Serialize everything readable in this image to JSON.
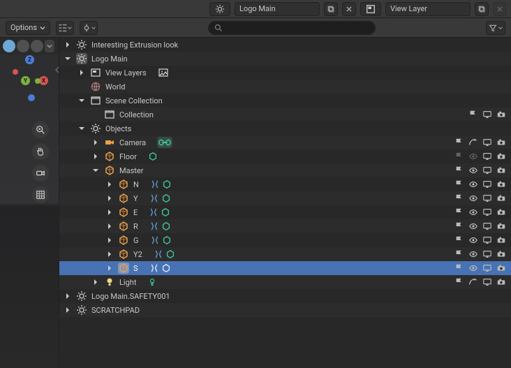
{
  "header": {
    "scene_field_label": "Logo Main",
    "layer_field_label": "View Layer"
  },
  "toolbar": {
    "options_label": "Options",
    "search_placeholder": ""
  },
  "outliner": {
    "rows": [
      {
        "depth": 0,
        "tw": "r",
        "icon": "scene",
        "label": "Interesting Extrusion look",
        "alt": false,
        "right": []
      },
      {
        "depth": 0,
        "tw": "d",
        "icon": "scene",
        "label": "Logo Main",
        "alt": true,
        "boxed": true,
        "right": []
      },
      {
        "depth": 1,
        "tw": "r",
        "icon": "layers",
        "label": "View Layers",
        "alt": false,
        "extra": "img",
        "right": []
      },
      {
        "depth": 1,
        "tw": "",
        "icon": "world",
        "label": "World",
        "alt": true,
        "right": []
      },
      {
        "depth": 1,
        "tw": "d",
        "icon": "collection",
        "label": "Scene Collection",
        "alt": false,
        "right": []
      },
      {
        "depth": 2,
        "tw": "",
        "icon": "collection",
        "label": "Collection",
        "alt": true,
        "right": [
          "flag",
          "screen",
          "render"
        ]
      },
      {
        "depth": 1,
        "tw": "d",
        "icon": "scene",
        "label": "Objects",
        "alt": false,
        "right": []
      },
      {
        "depth": 2,
        "tw": "r",
        "icon": "camera",
        "label": "Camera",
        "alt": true,
        "extra": "link",
        "right": [
          "flag",
          "arc",
          "screen",
          "render"
        ]
      },
      {
        "depth": 2,
        "tw": "r",
        "icon": "mesh",
        "label": "Floor",
        "alt": false,
        "extra": "shape",
        "right": [
          "flag-dim",
          "eye-dim",
          "screen",
          "render"
        ]
      },
      {
        "depth": 2,
        "tw": "d",
        "icon": "mesh",
        "label": "Master",
        "alt": true,
        "right": [
          "flag",
          "eye",
          "screen",
          "render"
        ]
      },
      {
        "depth": 3,
        "tw": "r",
        "icon": "mesh",
        "label": "N",
        "alt": false,
        "extra": "mod-shape",
        "right": [
          "flag",
          "eye",
          "screen",
          "render"
        ]
      },
      {
        "depth": 3,
        "tw": "r",
        "icon": "mesh",
        "label": "Y",
        "alt": true,
        "extra": "mod-shape",
        "right": [
          "flag",
          "eye",
          "screen",
          "render"
        ]
      },
      {
        "depth": 3,
        "tw": "r",
        "icon": "mesh",
        "label": "E",
        "alt": false,
        "extra": "mod-shape",
        "right": [
          "flag",
          "eye",
          "screen",
          "render"
        ]
      },
      {
        "depth": 3,
        "tw": "r",
        "icon": "mesh",
        "label": "R",
        "alt": true,
        "extra": "mod-shape",
        "right": [
          "flag",
          "eye",
          "screen",
          "render"
        ]
      },
      {
        "depth": 3,
        "tw": "r",
        "icon": "mesh",
        "label": "G",
        "alt": false,
        "extra": "mod-shape",
        "right": [
          "flag",
          "eye",
          "screen",
          "render"
        ]
      },
      {
        "depth": 3,
        "tw": "r",
        "icon": "mesh",
        "label": "Y2",
        "alt": true,
        "extra": "mod-shape",
        "right": [
          "flag",
          "eye",
          "screen",
          "render"
        ]
      },
      {
        "depth": 3,
        "tw": "r",
        "icon": "mesh",
        "label": "S",
        "alt": false,
        "sel": true,
        "extra": "mod-shape-sel",
        "right": [
          "flag",
          "eye",
          "screen",
          "render"
        ]
      },
      {
        "depth": 2,
        "tw": "r",
        "icon": "light",
        "label": "Light",
        "alt": true,
        "extra": "lightdata",
        "right": [
          "flag",
          "arc",
          "screen",
          "render"
        ]
      },
      {
        "depth": 0,
        "tw": "r",
        "icon": "scene",
        "label": "Logo Main.SAFETY001",
        "alt": false,
        "right": []
      },
      {
        "depth": 0,
        "tw": "r",
        "icon": "scene",
        "label": "SCRATCHPAD",
        "alt": true,
        "right": []
      }
    ]
  }
}
